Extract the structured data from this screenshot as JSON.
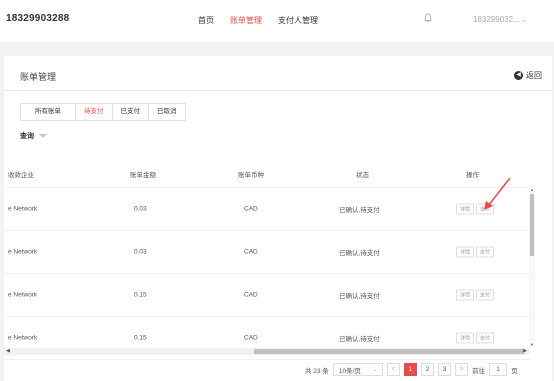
{
  "header": {
    "account": "18329903288",
    "nav": [
      "首页",
      "账单管理",
      "支付人管理"
    ],
    "active_nav": 1,
    "user": "183299032...",
    "bell_icon": "bell-icon",
    "accent": "#e94b4b"
  },
  "page": {
    "title": "账单管理",
    "back_label": "返回",
    "tabs": [
      "所有账单",
      "待支付",
      "已支付",
      "已取消"
    ],
    "active_tab": 1,
    "query_label": "查询"
  },
  "table": {
    "headers": [
      "收款企业",
      "账单金额",
      "账单币种",
      "状态",
      "操作"
    ],
    "rows": [
      {
        "company": "e Network",
        "amount": "0.03",
        "currency": "CAD",
        "status": "已确认,待支付",
        "actions": [
          "详情",
          "支付"
        ]
      },
      {
        "company": "e Network",
        "amount": "0.03",
        "currency": "CAD",
        "status": "已确认,待支付",
        "actions": [
          "详情",
          "支付"
        ]
      },
      {
        "company": "e Network",
        "amount": "0.15",
        "currency": "CAD",
        "status": "已确认,待支付",
        "actions": [
          "详情",
          "支付"
        ]
      },
      {
        "company": "e Network",
        "amount": "0.15",
        "currency": "CAD",
        "status": "已确认,待支付",
        "actions": [
          "详情",
          "支付"
        ]
      }
    ]
  },
  "pagination": {
    "total": "共 23 条",
    "page_size": "10条/页",
    "prev": "<",
    "pages": [
      "1",
      "2",
      "3"
    ],
    "current": "1",
    "next": ">",
    "goto_label": "前往",
    "goto_value": "1",
    "page_unit": "页"
  }
}
